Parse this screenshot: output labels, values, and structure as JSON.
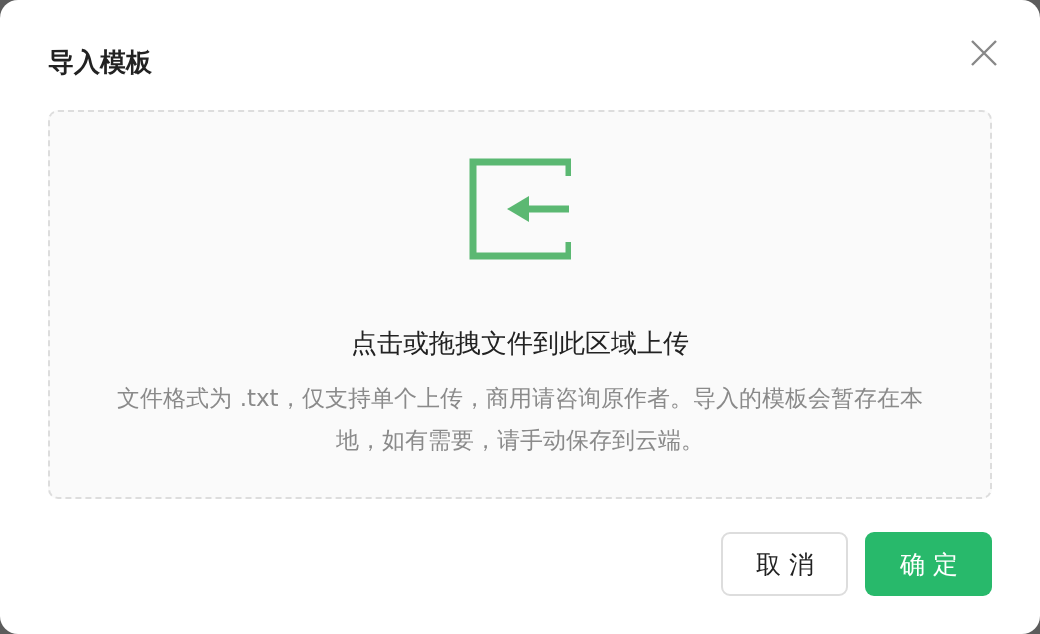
{
  "dialog": {
    "title": "导入模板"
  },
  "upload": {
    "prompt": "点击或拖拽文件到此区域上传",
    "hint": "文件格式为 .txt，仅支持单个上传，商用请咨询原作者。导入的模板会暂存在本地，如有需要，请手动保存到云端。"
  },
  "buttons": [
    {
      "label": "取消",
      "kind": "secondary"
    },
    {
      "label": "确定",
      "kind": "primary"
    }
  ]
}
